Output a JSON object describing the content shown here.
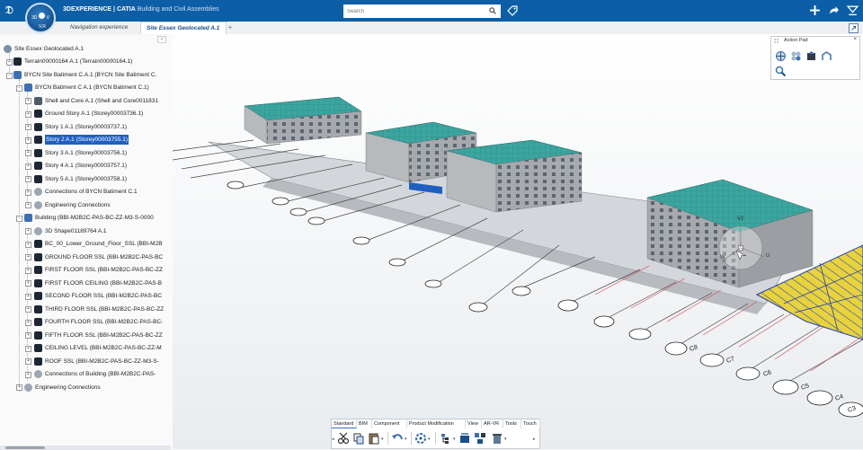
{
  "titlebar": {
    "brand": "3DEXPERIENCE",
    "app": "CATIA",
    "product": "Building and Civil Assemblies",
    "compass": {
      "left": "3D",
      "right": "V",
      "bottom": "V,R"
    }
  },
  "search": {
    "placeholder": "Search",
    "value": ""
  },
  "tabs": [
    {
      "label": "Navigation experience"
    },
    {
      "label": "Site Essex Geolocated A.1"
    }
  ],
  "tab_add": "+",
  "tree": {
    "items": [
      {
        "label": "Site Essex Geolocated A.1",
        "icon": "site-root-icon"
      },
      {
        "label": "Terrain00000164 A.1 (Terrain00000164.1)",
        "icon": "terrain-icon"
      },
      {
        "label": "BYCN Site Batiment C.A.1 (BYCN Site Batiment C.",
        "icon": "site-building-icon"
      },
      {
        "label": "BYCN Batiment C A.1 (BYCN Batiment C.1)",
        "icon": "building-icon"
      },
      {
        "label": "Shell and Core A.1 (Shell and Core0011831",
        "icon": "shell-icon"
      },
      {
        "label": "Ground Story A.1 (Storey00003736.1)",
        "icon": "storey-icon"
      },
      {
        "label": "Story 1 A.1 (Storey00003737.1)",
        "icon": "storey-icon"
      },
      {
        "label": "Story 2 A.1 (Storey00003755.1)",
        "icon": "storey-icon",
        "selected": true
      },
      {
        "label": "Story 3 A.1 (Storey00003756.1)",
        "icon": "storey-icon"
      },
      {
        "label": "Story 4 A.1 (Storey00003757.1)",
        "icon": "storey-icon"
      },
      {
        "label": "Story 5 A.1 (Storey00003758.1)",
        "icon": "storey-icon"
      },
      {
        "label": "Connections of BYCN Batiment C.1",
        "icon": "connections-icon"
      },
      {
        "label": "Engineering Connections",
        "icon": "engineering-connections-icon"
      },
      {
        "label": "Building (BBI-M2B2C-PAS-BC-ZZ-M3-S-0000",
        "icon": "building-icon"
      },
      {
        "label": "3D Shape01189764 A.1",
        "icon": "shape-icon"
      },
      {
        "label": "BC_00_Lower_Ground_Floor_SSL (BBI-M2B",
        "icon": "floor-icon"
      },
      {
        "label": "GROUND FLOOR SSL (BBI-M2B2C-PAS-BC",
        "icon": "floor-icon"
      },
      {
        "label": "FIRST FLOOR SSL (BBI-M2B2C-PAS-BC-ZZ",
        "icon": "floor-icon"
      },
      {
        "label": "FIRST FLOOR CEILING (BBI-M2B2C-PAS-B",
        "icon": "floor-icon"
      },
      {
        "label": "SECOND FLOOR SSL (BBI-M2B2C-PAS-BC",
        "icon": "floor-icon"
      },
      {
        "label": "THIRD FLOOR SSL (BBI-M2B2C-PAS-BC-ZZ",
        "icon": "floor-icon"
      },
      {
        "label": "FOURTH FLOOR SSL (BBI-M2B2C-PAS-BC-",
        "icon": "floor-icon"
      },
      {
        "label": "FIFTH FLOOR SSL (BBI-M2B2C-PAS-BC-ZZ",
        "icon": "floor-icon"
      },
      {
        "label": "CEILING LEVEL (BBI-M2B2C-PAS-BC-ZZ-M",
        "icon": "floor-icon"
      },
      {
        "label": "ROOF SSL (BBI-M2B2C-PAS-BC-ZZ-M3-S-",
        "icon": "floor-icon"
      },
      {
        "label": "Connections of Building (BBI-M2B2C-PAS-",
        "icon": "connections-icon"
      },
      {
        "label": "Engineering Connections",
        "icon": "engineering-connections-icon"
      }
    ]
  },
  "action_pad": {
    "title": "Action Pad",
    "close": "×"
  },
  "toolbar": {
    "tabs": [
      "Standard",
      "BIM",
      "Component",
      "Product Modification",
      "View",
      "AR-VR",
      "Tools",
      "Touch"
    ],
    "active_tab": "Standard"
  },
  "viewport": {
    "manipulator_labels": [
      "V2",
      "W",
      "U"
    ],
    "grid_labels": [
      "C8",
      "C7",
      "C6",
      "C5",
      "C4",
      "C3"
    ],
    "colors": {
      "roof": "#3ba6a0",
      "slab": "#e9d23a",
      "selection": "#1f5fc2",
      "wall": "#a6a9ad"
    }
  }
}
